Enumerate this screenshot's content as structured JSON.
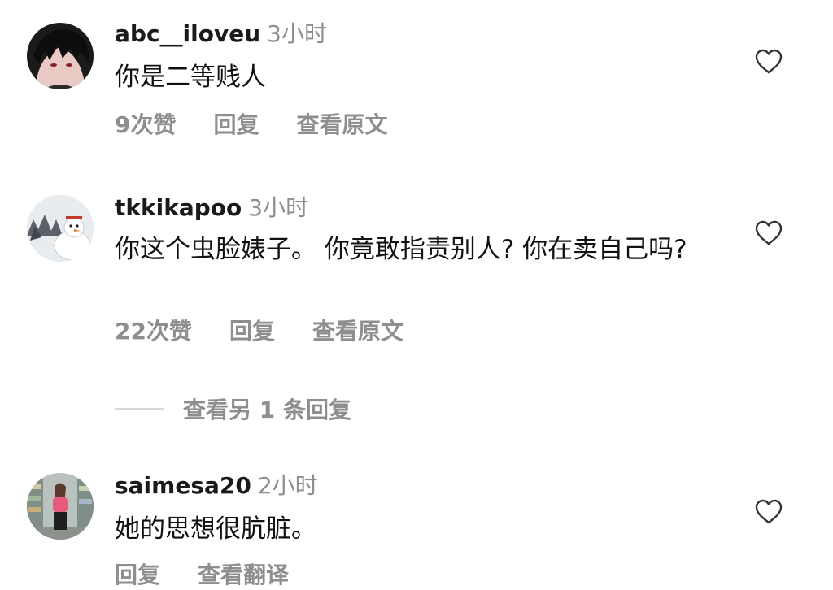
{
  "comments": [
    {
      "username": "abc__iloveu",
      "time": "3小时",
      "text": "你是二等贱人",
      "likes": "9次赞",
      "reply": "回复",
      "translate": "查看原文"
    },
    {
      "username": "tkkikapoo",
      "time": "3小时",
      "text": "你这个虫脸婊子。 你竟敢指责别人? 你在卖自己吗?",
      "likes": "22次赞",
      "reply": "回复",
      "translate": "查看原文"
    },
    {
      "username": "saimesa20",
      "time": "2小时",
      "text": "她的思想很肮脏。",
      "reply": "回复",
      "translate": "查看翻译"
    }
  ],
  "view_more_replies": "查看另 1 条回复",
  "icons": {
    "like": "heart-outline-icon"
  },
  "colors": {
    "secondary_text": "#8e8e8e",
    "primary_text": "#111111",
    "divider": "#d8d8d8"
  }
}
